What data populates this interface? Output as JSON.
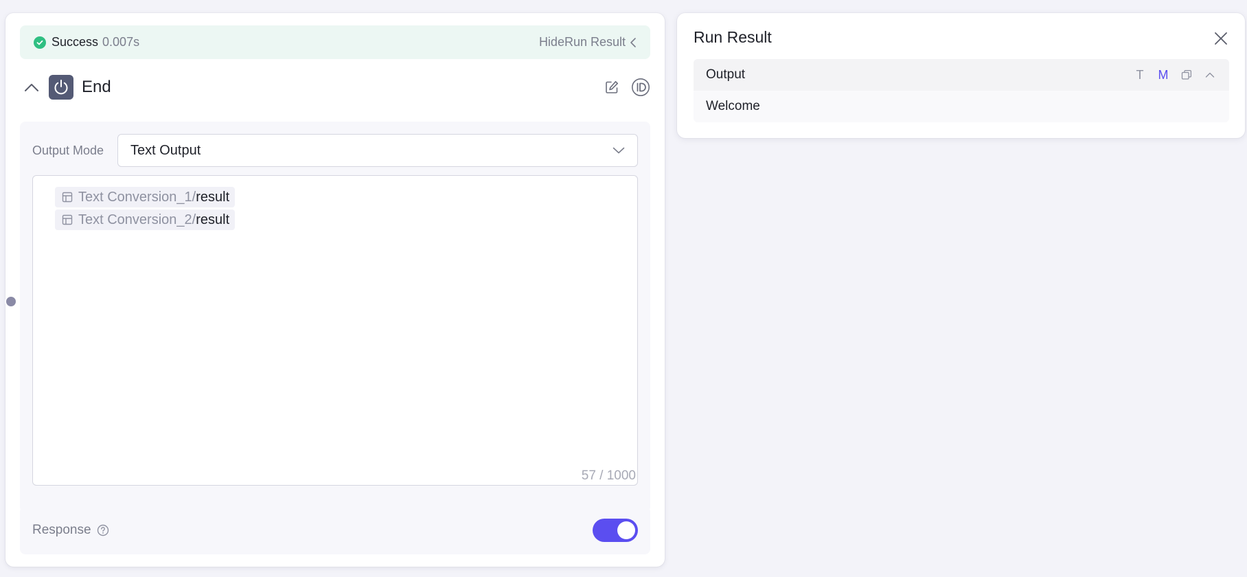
{
  "status": {
    "label": "Success",
    "time": "0.007s",
    "toggle_label": "HideRun Result"
  },
  "node": {
    "title": "End",
    "output_mode_label": "Output Mode",
    "output_mode_value": "Text Output",
    "variables": [
      {
        "node": "Text Conversion_1",
        "separator": "/",
        "field": "result"
      },
      {
        "node": "Text Conversion_2",
        "separator": "/",
        "field": "result"
      }
    ],
    "char_count": "57 / 1000",
    "response_label": "Response",
    "response_enabled": true
  },
  "run_result": {
    "title": "Run Result",
    "output_title": "Output",
    "format_text_label": "T",
    "format_markdown_label": "M",
    "output_value": "Welcome"
  },
  "colors": {
    "accent": "#5b4ef0",
    "success": "#2fbf82",
    "node_icon_bg": "#545a75"
  },
  "icons": {
    "status": "check-circle-icon",
    "toggle": "chevron-left-icon",
    "collapse": "chevron-up-icon",
    "node": "power-icon",
    "edit": "edit-icon",
    "id": "id-icon",
    "select": "chevron-down-icon",
    "variable": "table-icon",
    "help": "question-circle-icon",
    "close": "close-icon",
    "copy": "copy-icon",
    "collapse_output": "chevron-up-icon"
  }
}
